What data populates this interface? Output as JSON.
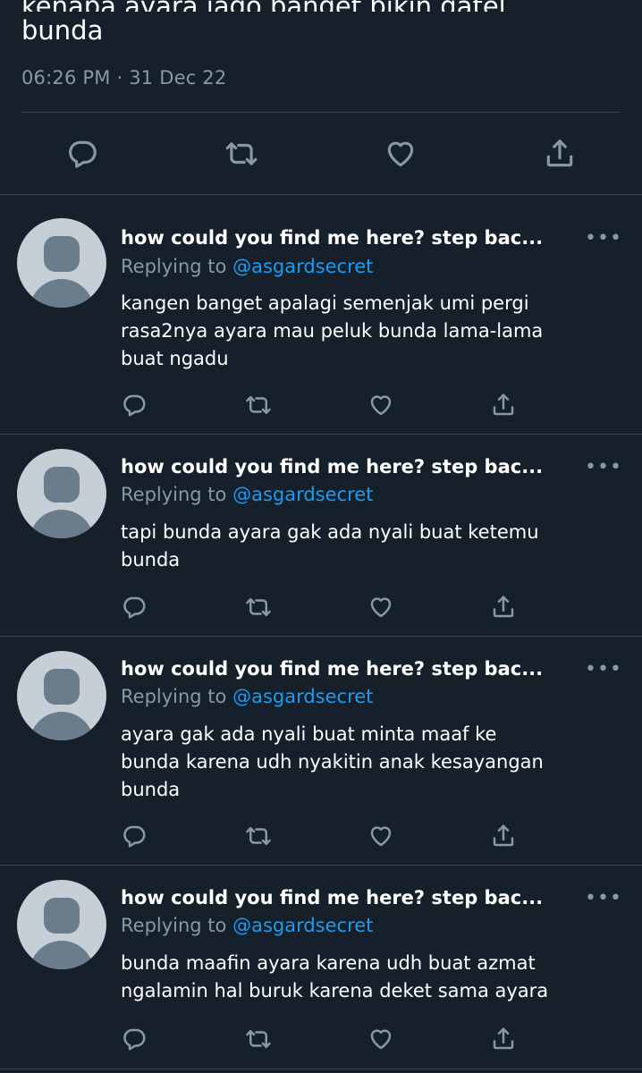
{
  "main_tweet": {
    "text_clipped_line": "kenapa ayara jago banget bikin gatel",
    "text_last_line": "bunda",
    "timestamp": "06:26 PM · 31 Dec 22"
  },
  "replies": [
    {
      "name": "how could you find me here? step bac...",
      "replying_prefix": "Replying to ",
      "handle": "@asgardsecret",
      "text_lines": [
        "kangen banget apalagi semenjak umi pergi",
        "rasa2nya ayara mau peluk bunda lama-lama",
        "buat ngadu"
      ]
    },
    {
      "name": "how could you find me here? step bac...",
      "replying_prefix": "Replying to ",
      "handle": "@asgardsecret",
      "text_lines": [
        "tapi bunda ayara gak ada nyali buat ketemu",
        "bunda"
      ]
    },
    {
      "name": "how could you find me here? step bac...",
      "replying_prefix": "Replying to ",
      "handle": "@asgardsecret",
      "text_lines": [
        "ayara gak ada nyali buat minta maaf ke",
        "bunda karena udh nyakitin anak kesayangan",
        "bunda"
      ]
    },
    {
      "name": "how could you find me here? step bac...",
      "replying_prefix": "Replying to ",
      "handle": "@asgardsecret",
      "text_lines": [
        "bunda maafin ayara karena udh buat azmat",
        "ngalamin hal buruk karena deket sama ayara"
      ]
    }
  ],
  "more_label": "•••",
  "icons": [
    "reply-icon",
    "retweet-icon",
    "like-icon",
    "share-icon"
  ],
  "colors": {
    "background": "#15202b",
    "secondary_text": "#8899a6",
    "link": "#1d9bf0",
    "divider": "#38444d"
  }
}
